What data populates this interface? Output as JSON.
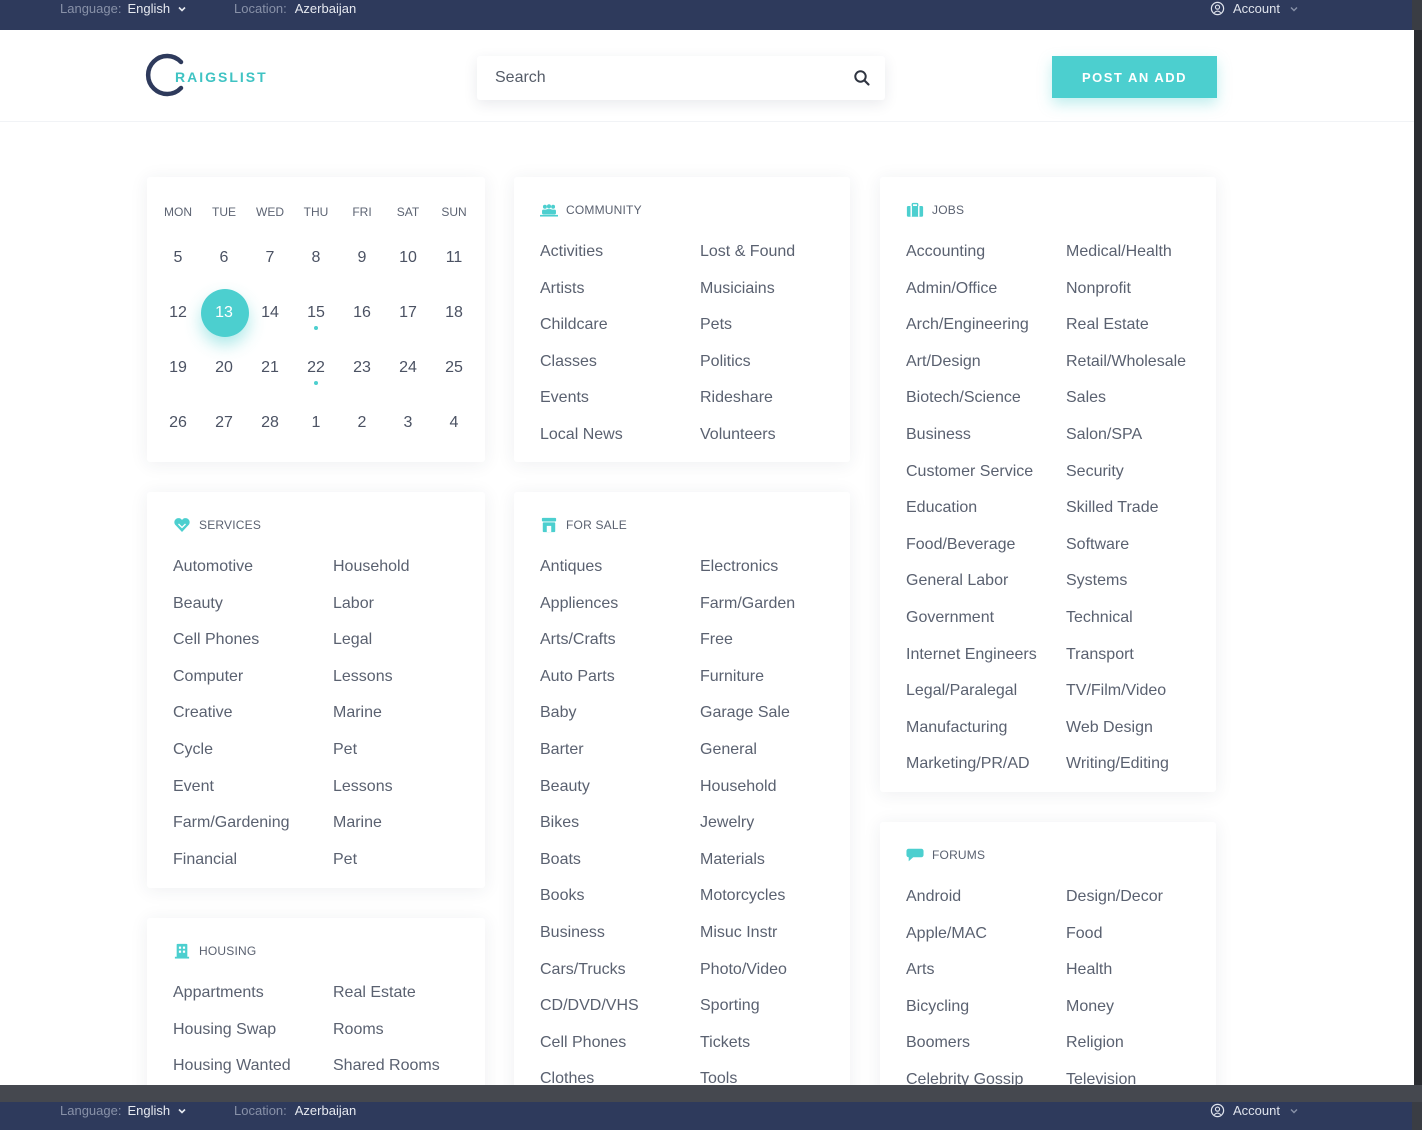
{
  "topbar": {
    "language_label": "Language:",
    "language_value": "English",
    "location_label": "Location:",
    "location_value": "Azerbaijan",
    "account_label": "Account"
  },
  "header": {
    "logo_text": "RAIGSLIST",
    "search_placeholder": "Search",
    "post_button": "POST AN ADD"
  },
  "colors": {
    "accent": "#4ccfcf",
    "topbar": "#2e3a5c",
    "text": "#5a6170"
  },
  "calendar": {
    "weekdays": [
      "MON",
      "TUE",
      "WED",
      "THU",
      "FRI",
      "SAT",
      "SUN"
    ],
    "weeks": [
      [
        "5",
        "6",
        "7",
        "8",
        "9",
        "10",
        "11"
      ],
      [
        "12",
        "13",
        "14",
        "15",
        "16",
        "17",
        "18"
      ],
      [
        "19",
        "20",
        "21",
        "22",
        "23",
        "24",
        "25"
      ],
      [
        "26",
        "27",
        "28",
        "1",
        "2",
        "3",
        "4"
      ]
    ],
    "selected": "13",
    "marked": [
      "15",
      "22"
    ]
  },
  "community": {
    "title": "COMMUNITY",
    "icon": "people-icon",
    "col1": [
      "Activities",
      "Artists",
      "Childcare",
      "Classes",
      "Events",
      "Local News"
    ],
    "col2": [
      "Lost & Found",
      "Musiciains",
      "Pets",
      "Politics",
      "Rideshare",
      "Volunteers"
    ]
  },
  "jobs": {
    "title": "JOBS",
    "icon": "briefcase-icon",
    "col1": [
      "Accounting",
      "Admin/Office",
      "Arch/Engineering",
      "Art/Design",
      "Biotech/Science",
      "Business",
      "Customer Service",
      "Education",
      "Food/Beverage",
      "General Labor",
      "Government",
      "Internet Engineers",
      "Legal/Paralegal",
      "Manufacturing",
      "Marketing/PR/AD"
    ],
    "col2": [
      "Medical/Health",
      "Nonprofit",
      "Real Estate",
      "Retail/Wholesale",
      "Sales",
      "Salon/SPA",
      "Security",
      "Skilled Trade",
      "Software",
      "Systems",
      "Technical",
      "Transport",
      "TV/Film/Video",
      "Web Design",
      "Writing/Editing"
    ]
  },
  "services": {
    "title": "SERVICES",
    "icon": "heart-icon",
    "col1": [
      "Automotive",
      "Beauty",
      "Cell Phones",
      "Computer",
      "Creative",
      "Cycle",
      "Event",
      "Farm/Gardening",
      "Financial"
    ],
    "col2": [
      "Household",
      "Labor",
      "Legal",
      "Lessons",
      "Marine",
      "Pet",
      "Lessons",
      "Marine",
      "Pet"
    ]
  },
  "forsale": {
    "title": "FOR SALE",
    "icon": "store-icon",
    "col1": [
      "Antiques",
      "Appliences",
      "Arts/Crafts",
      "Auto Parts",
      "Baby",
      "Barter",
      "Beauty",
      "Bikes",
      "Boats",
      "Books",
      "Business",
      "Cars/Trucks",
      "CD/DVD/VHS",
      "Cell Phones",
      "Clothes"
    ],
    "col2": [
      "Electronics",
      "Farm/Garden",
      "Free",
      "Furniture",
      "Garage Sale",
      "General",
      "Household",
      "Jewelry",
      "Materials",
      "Motorcycles",
      "Misuc Instr",
      "Photo/Video",
      "Sporting",
      "Tickets",
      "Tools"
    ]
  },
  "housing": {
    "title": "HOUSING",
    "icon": "building-icon",
    "col1": [
      "Appartments",
      "Housing Swap",
      "Housing Wanted"
    ],
    "col2": [
      "Real Estate",
      "Rooms",
      "Shared Rooms"
    ]
  },
  "forums": {
    "title": "FORUMS",
    "icon": "chat-bubble-icon",
    "col1": [
      "Android",
      "Apple/MAC",
      "Arts",
      "Bicycling",
      "Boomers",
      "Celebrity Gossip"
    ],
    "col2": [
      "Design/Decor",
      "Food",
      "Health",
      "Money",
      "Religion",
      "Television"
    ]
  }
}
